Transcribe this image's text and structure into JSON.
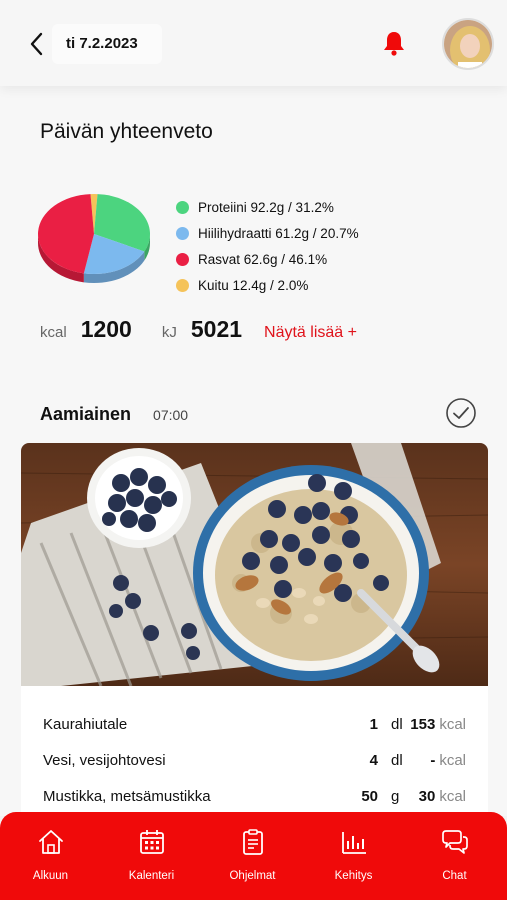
{
  "header": {
    "date": "ti 7.2.2023"
  },
  "summary": {
    "title": "Päivän yhteenveto",
    "legend": [
      {
        "label": "Proteiini 92.2g / 31.2%",
        "color": "#4cd47f"
      },
      {
        "label": "Hiilihydraatti 61.2g / 20.7%",
        "color": "#7cb9ee"
      },
      {
        "label": "Rasvat 62.6g / 46.1%",
        "color": "#ea1f44"
      },
      {
        "label": "Kuitu 12.4g / 2.0%",
        "color": "#f5c35a"
      }
    ],
    "kcal_unit": "kcal",
    "kcal_value": "1200",
    "kj_unit": "kJ",
    "kj_value": "5021",
    "more_label": "Näytä lisää +"
  },
  "chart_data": {
    "type": "pie",
    "categories": [
      "Proteiini",
      "Hiilihydraatti",
      "Rasvat",
      "Kuitu"
    ],
    "values": [
      31.2,
      20.7,
      46.1,
      2.0
    ],
    "colors": [
      "#4cd47f",
      "#7cb9ee",
      "#ea1f44",
      "#f5c35a"
    ]
  },
  "meal": {
    "name": "Aamiainen",
    "time": "07:00",
    "items": [
      {
        "name": "Kaurahiutale",
        "amount": "1",
        "unit": "dl",
        "kcal": "153",
        "kcal_unit": "kcal"
      },
      {
        "name": "Vesi, vesijohtovesi",
        "amount": "4",
        "unit": "dl",
        "kcal": "-",
        "kcal_unit": "kcal"
      },
      {
        "name": "Mustikka, metsämustikka",
        "amount": "50",
        "unit": "g",
        "kcal": "30",
        "kcal_unit": "kcal"
      }
    ]
  },
  "nav": {
    "items": [
      {
        "label": "Alkuun",
        "icon": "home-icon"
      },
      {
        "label": "Kalenteri",
        "icon": "calendar-icon"
      },
      {
        "label": "Ohjelmat",
        "icon": "clipboard-icon"
      },
      {
        "label": "Kehitys",
        "icon": "bar-chart-icon"
      },
      {
        "label": "Chat",
        "icon": "chat-icon"
      }
    ]
  }
}
